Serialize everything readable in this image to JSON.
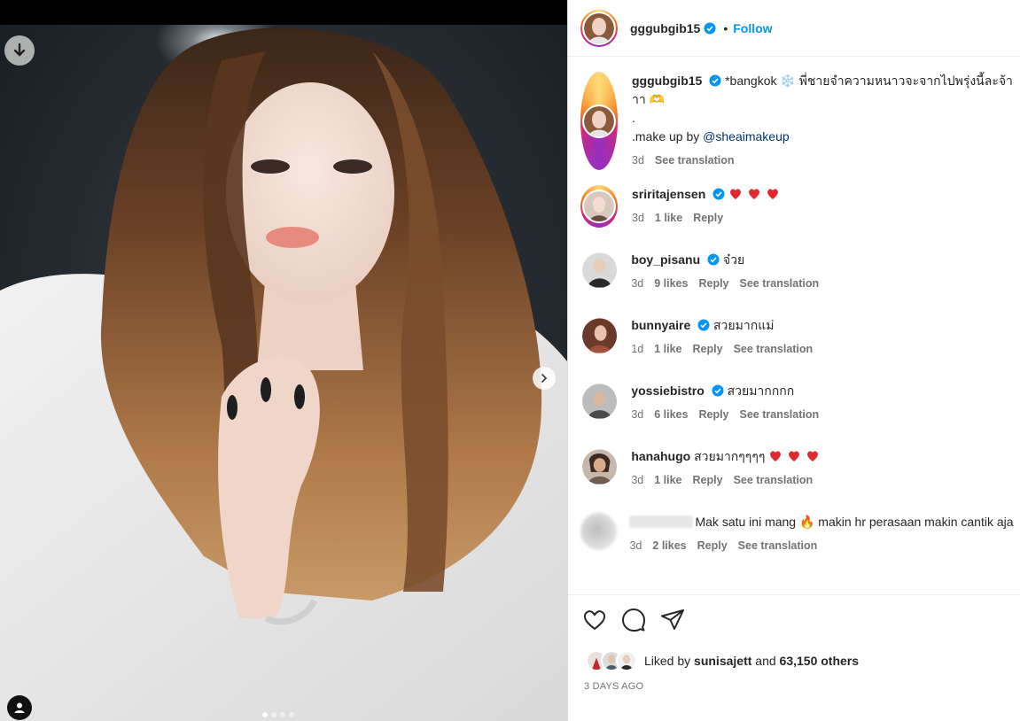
{
  "post": {
    "author": "gggubgib15",
    "follow_label": "Follow",
    "separator": "•",
    "caption_line1": "*bangkok ❄️ พี่ชายจำความหนาวจะจากไปพรุ่งนี้ละจ้าาา 🫶",
    "caption_line2": ".",
    "caption_prefix": ".make up by ",
    "caption_mention": "@sheaimakeup",
    "caption_time": "3d",
    "caption_translate": "See translation",
    "media_dots": 4,
    "active_dot": 0
  },
  "comments": [
    {
      "user": "sriritajensen",
      "verified": true,
      "text": "",
      "hearts": 3,
      "time": "3d",
      "likes": "1 like",
      "reply": "Reply",
      "translate": ""
    },
    {
      "user": "boy_pisanu",
      "verified": true,
      "text": "จ๋วย",
      "hearts": 0,
      "time": "3d",
      "likes": "9 likes",
      "reply": "Reply",
      "translate": "See translation"
    },
    {
      "user": "bunnyaire",
      "verified": true,
      "text": "สวยมากแม่",
      "hearts": 0,
      "time": "1d",
      "likes": "1 like",
      "reply": "Reply",
      "translate": "See translation"
    },
    {
      "user": "yossiebistro",
      "verified": true,
      "text": "สวยมากกกก",
      "hearts": 0,
      "time": "3d",
      "likes": "6 likes",
      "reply": "Reply",
      "translate": "See translation"
    },
    {
      "user": "hanahugo",
      "verified": false,
      "text": "สวยมากๆๆๆๆ",
      "hearts": 3,
      "time": "3d",
      "likes": "1 like",
      "reply": "Reply",
      "translate": "See translation"
    },
    {
      "user": "",
      "verified": false,
      "text": "Mak satu ini mang 🔥 makin hr perasaan makin cantik aja",
      "hearts": 0,
      "time": "3d",
      "likes": "2 likes",
      "reply": "Reply",
      "translate": "See translation"
    }
  ],
  "footer": {
    "liked_prefix": "Liked by",
    "liked_user": "sunisajett",
    "liked_and": "and",
    "liked_count": "63,150 others",
    "posted_ago": "3 DAYS AGO"
  },
  "icons": [
    "download-icon",
    "chevron-right-icon",
    "user-tag-icon",
    "verified-badge-icon",
    "heart-icon",
    "comment-icon",
    "share-icon"
  ],
  "colors": {
    "accent": "#0095f6",
    "heart": "#ed4956",
    "verified": "#0095f6",
    "mention": "#00376b",
    "secondary_text": "#737373"
  }
}
